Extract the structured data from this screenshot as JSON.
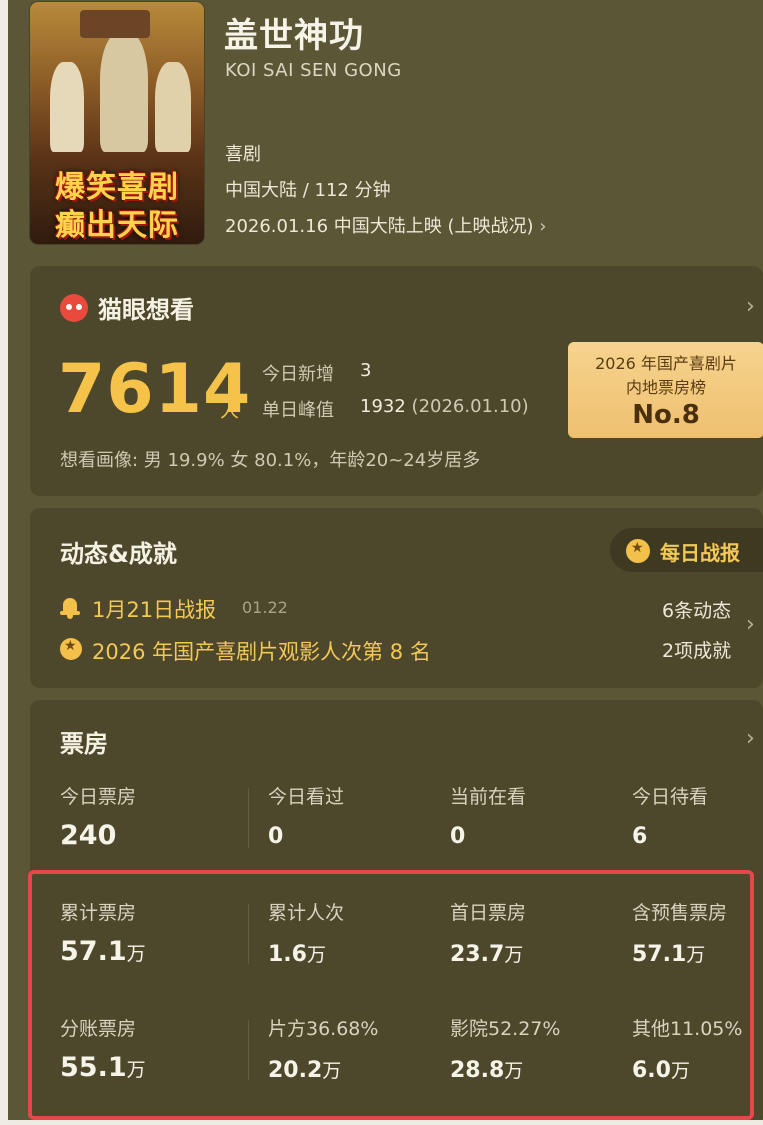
{
  "movie": {
    "title": "盖世神功",
    "title_en": "KOI SAI SEN GONG",
    "genre": "喜剧",
    "region_duration": "中国大陆 / 112 分钟",
    "release": "2026.01.16 中国大陆上映 (上映战况)",
    "poster_line1": "爆笑喜剧",
    "poster_line2": "癫出天际"
  },
  "want": {
    "heading": "猫眼想看",
    "count": "7614",
    "unit": "人",
    "today_label": "今日新增",
    "today_value": "3",
    "peak_label": "单日峰值",
    "peak_value": "1932",
    "peak_date": "(2026.01.10)",
    "demographics": "想看画像: 男 19.9%  女 80.1%，年龄20~24岁居多",
    "rank_line1": "2026 年国产喜剧片",
    "rank_line2": "内地票房榜",
    "rank_value": "No.8"
  },
  "activity": {
    "heading": "动态&成就",
    "daily_button": "每日战报",
    "report": "1月21日战报",
    "report_date": "01.22",
    "achievement": "2026 年国产喜剧片观影人次第 8 名",
    "updates_count": "6条动态",
    "achievements_count": "2项成就"
  },
  "box_office": {
    "heading": "票房",
    "row1": [
      {
        "label": "今日票房",
        "value": "240",
        "unit": ""
      },
      {
        "label": "今日看过",
        "value": "0",
        "unit": ""
      },
      {
        "label": "当前在看",
        "value": "0",
        "unit": ""
      },
      {
        "label": "今日待看",
        "value": "6",
        "unit": ""
      }
    ],
    "row2": [
      {
        "label": "累计票房",
        "value": "57.1",
        "unit": "万"
      },
      {
        "label": "累计人次",
        "value": "1.6",
        "unit": "万"
      },
      {
        "label": "首日票房",
        "value": "23.7",
        "unit": "万"
      },
      {
        "label": "含预售票房",
        "value": "57.1",
        "unit": "万"
      }
    ],
    "row3": [
      {
        "label": "分账票房",
        "value": "55.1",
        "unit": "万"
      },
      {
        "label": "片方36.68%",
        "value": "20.2",
        "unit": "万"
      },
      {
        "label": "影院52.27%",
        "value": "28.8",
        "unit": "万"
      },
      {
        "label": "其他11.05%",
        "value": "6.0",
        "unit": "万"
      }
    ]
  },
  "colors": {
    "background": "#5b5636",
    "card": "#4d482c",
    "accent_gold": "#f5c24a",
    "highlight_red": "#e5474a"
  },
  "icons": [
    "chevron-right-icon",
    "maoyan-cat-icon",
    "medal-icon",
    "bell-icon"
  ]
}
